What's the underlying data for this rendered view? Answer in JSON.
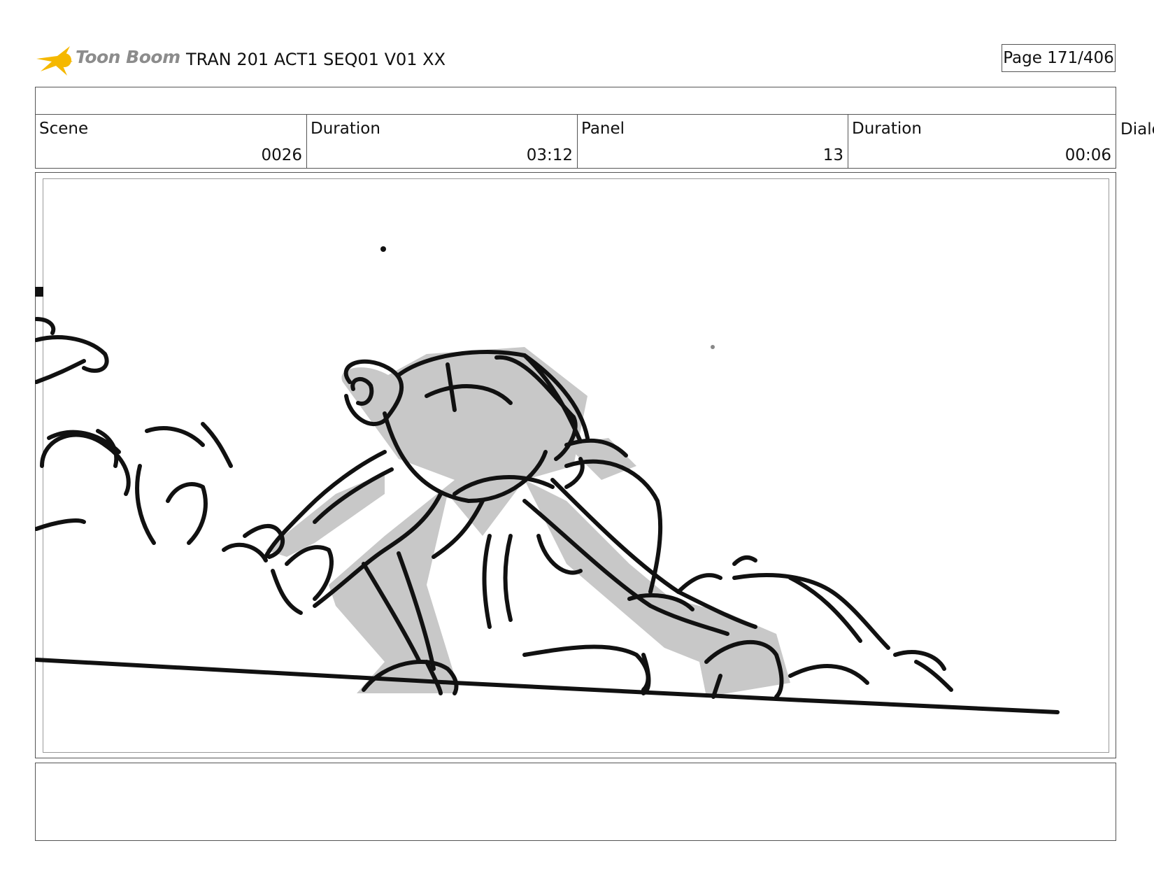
{
  "header": {
    "logo_text": "Toon Boom",
    "document_title": "TRAN 201 ACT1 SEQ01 V01 XX",
    "page_label": "Page 171/406"
  },
  "fields": [
    {
      "label": "Scene",
      "value": "0026"
    },
    {
      "label": "Duration",
      "value": "03:12"
    },
    {
      "label": "Panel",
      "value": "13"
    },
    {
      "label": "Duration",
      "value": "00:06"
    }
  ],
  "dialog_label": "Dialog",
  "colors": {
    "logo_star": "#f5b800",
    "logo_text": "#8c8c8c",
    "sketch_fill": "#c8c8c8",
    "ink": "#111111"
  },
  "icons": [
    "toon-boom-star-icon"
  ],
  "panel_image": "rough storyboard sketch"
}
